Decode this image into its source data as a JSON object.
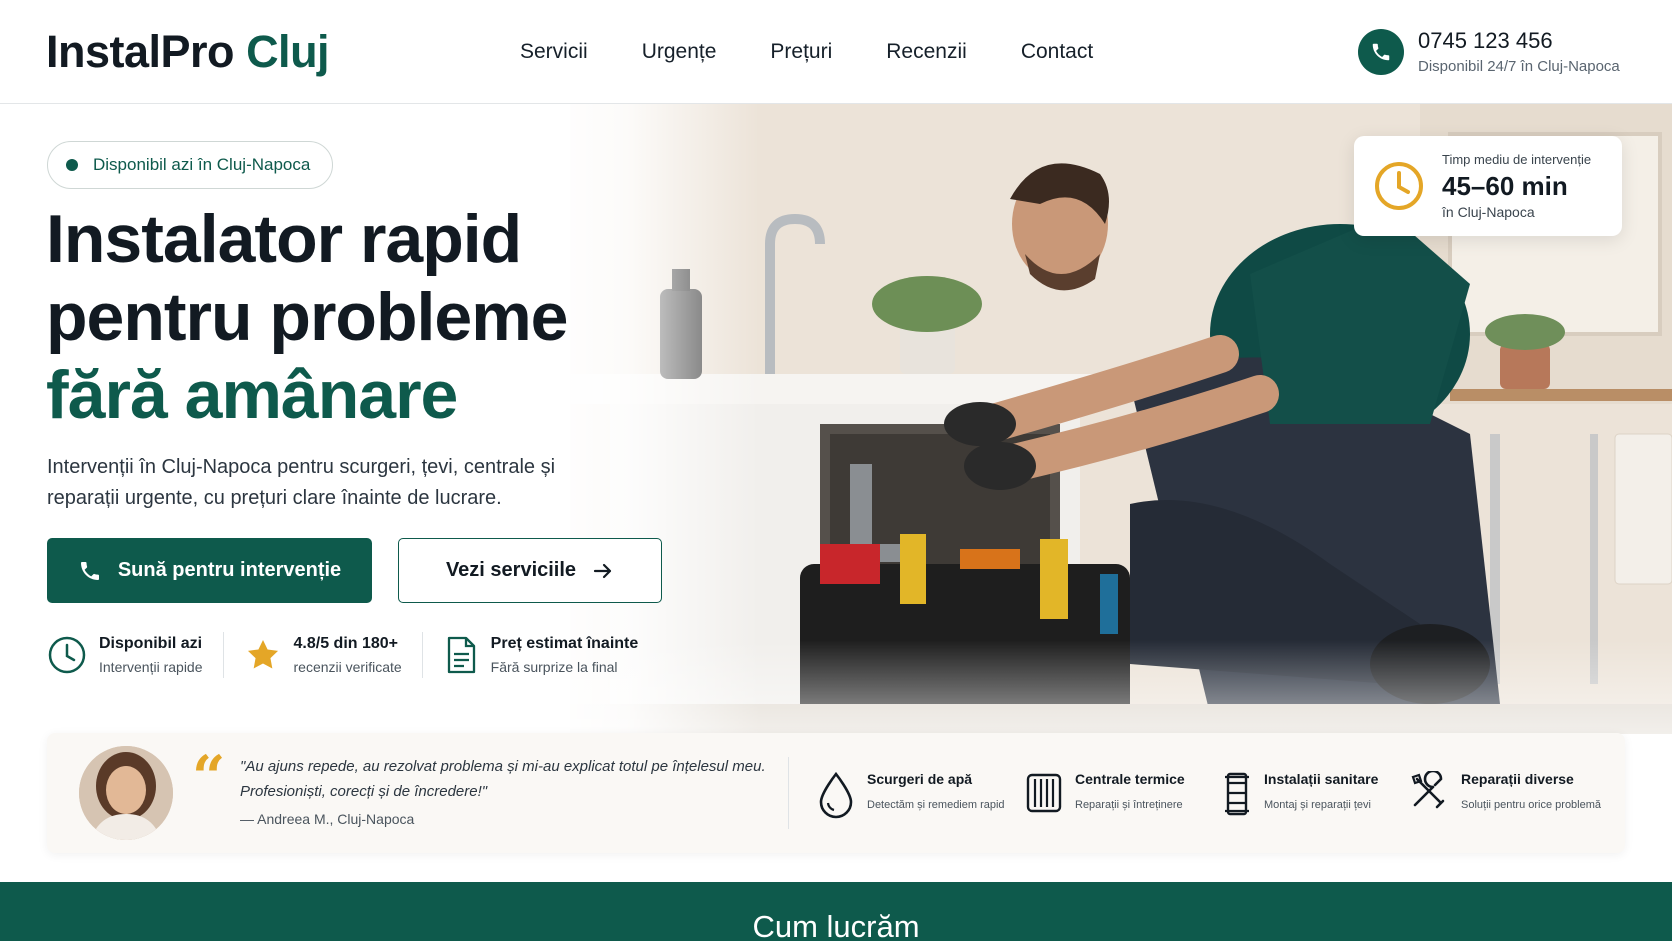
{
  "header": {
    "logo_main": "InstalPro",
    "logo_accent": "Cluj",
    "nav": [
      "Servicii",
      "Urgențe",
      "Prețuri",
      "Recenzii",
      "Contact"
    ],
    "phone": "0745 123 456",
    "phone_sub": "Disponibil 24/7 în Cluj-Napoca"
  },
  "hero": {
    "badge": "Disponibil azi în Cluj-Napoca",
    "title_line1": "Instalator rapid",
    "title_line2": "pentru probleme",
    "title_line3": "fără amânare",
    "lead": "Intervenții în Cluj-Napoca pentru scurgeri, țevi, centrale și reparații urgente, cu prețuri clare înainte de lucrare.",
    "btn_primary": "Sună pentru intervenție",
    "btn_secondary": "Vezi serviciile",
    "features": [
      {
        "title": "Disponibil azi",
        "sub": "Intervenții rapide",
        "icon": "clock-icon"
      },
      {
        "title": "4.8/5 din 180+",
        "sub": "recenzii verificate",
        "icon": "star-icon"
      },
      {
        "title": "Preț estimat înainte",
        "sub": "Fără surprize la final",
        "icon": "document-icon"
      }
    ]
  },
  "time_card": {
    "label": "Timp mediu de intervenție",
    "value": "45–60 min",
    "sub": "în Cluj-Napoca"
  },
  "testimonial": {
    "quote": "\"Au ajuns repede, au rezolvat problema și mi-au explicat totul pe înțelesul meu. Profesioniști, corecți și de încredere!\"",
    "author": "— Andreea M., Cluj-Napoca"
  },
  "services": [
    {
      "title": "Scurgeri de apă",
      "sub": "Detectăm și remediem rapid",
      "icon": "water-drop-icon"
    },
    {
      "title": "Centrale termice",
      "sub": "Reparații și întreținere",
      "icon": "radiator-icon"
    },
    {
      "title": "Instalații sanitare",
      "sub": "Montaj și reparații țevi",
      "icon": "pipe-icon"
    },
    {
      "title": "Reparații diverse",
      "sub": "Soluții pentru orice problemă",
      "icon": "tools-icon"
    }
  ],
  "section": {
    "title": "Cum lucrăm"
  },
  "colors": {
    "brand": "#0e5a4c",
    "accent": "#e4a627"
  }
}
